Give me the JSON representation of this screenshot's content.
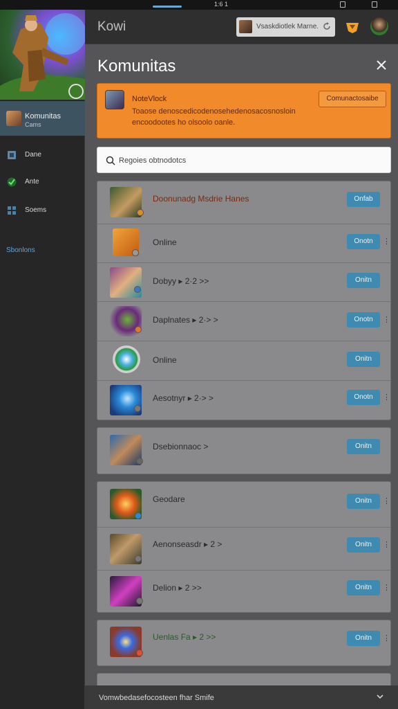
{
  "status_bar": {
    "time": "1:6 1"
  },
  "sidebar": {
    "active": {
      "title": "Komunitas",
      "subtitle": "Cams"
    },
    "items": [
      {
        "label": "Dane",
        "icon": "square-icon"
      },
      {
        "label": "Ante",
        "icon": "check-icon"
      },
      {
        "label": "Soems",
        "icon": "grid-icon"
      }
    ],
    "link": "Sbonlons"
  },
  "header": {
    "brand": "Kowi",
    "account_label": "Vsaskdiotlek Marne.",
    "gift_icon": "gift-icon",
    "avatar_icon": "user-avatar-icon"
  },
  "panel": {
    "title": "Komunitas",
    "notice": {
      "title": "NoteVlock",
      "body": "Toaose denoscedicodenosehedenosacosnosloin encoodootes ho olsoolo oanle.",
      "button": "Comunactosaibe"
    },
    "search_placeholder": "Regoies obtnodotcs",
    "groups": [
      {
        "rows": [
          {
            "name": "Doonunadg Msdrie Hanes",
            "button": "Onfab"
          },
          {
            "name": "Online",
            "button": "Onotn"
          },
          {
            "name": "Dobyy ▸ 2·2 >>",
            "button": "Onitn"
          },
          {
            "name": "Daplnates ▸ 2·> >",
            "button": "Onotn"
          },
          {
            "name": "Online",
            "button": "Onitn"
          },
          {
            "name": "Aesotnyr ▸ 2·> >",
            "button": "Onotn"
          }
        ]
      },
      {
        "rows": [
          {
            "name": "Dsebionnaoc >",
            "button": "Onitn"
          }
        ]
      },
      {
        "rows": [
          {
            "name": "Geodare",
            "button": "Onitn"
          },
          {
            "name": "Aenonseasdr ▸ 2 >",
            "button": "Onitn"
          },
          {
            "name": "Delion ▸ 2 >>",
            "button": "Onitn"
          }
        ]
      },
      {
        "rows": [
          {
            "name": "Uenlas Fa ▸ 2 >>",
            "button": "Onitn"
          }
        ]
      }
    ]
  },
  "footer": {
    "text": "Vomwbedasefocosteen fhar Smife"
  },
  "colors": {
    "accent": "#f08a2a",
    "button": "#3e8ab0",
    "panel": "#555557",
    "sidebar_active": "#3d5360",
    "link": "#5aa6d6"
  }
}
